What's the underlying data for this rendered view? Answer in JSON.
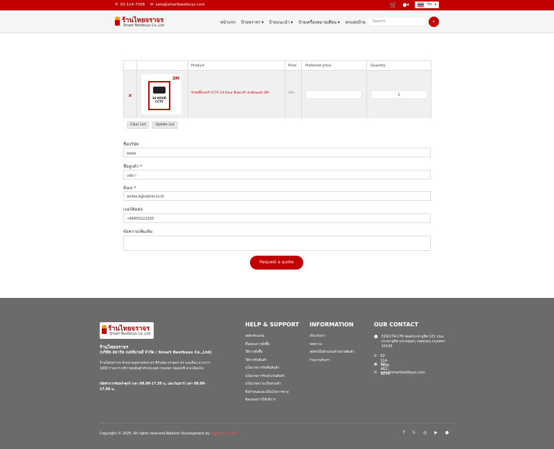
{
  "topbar": {
    "phone": "02-114-7006",
    "email": "sale@smartbestbuys.com",
    "lang": "TH"
  },
  "header": {
    "brand": "ร้านไทยจราจร",
    "brand_sub": "Smart Bestbuys Co.,Ltd",
    "search_placeholder": "Search",
    "nav": [
      "หน้าแรก",
      "ป้ายจราจร ▾",
      "ป้ายแนะนำ ▾",
      "ป้ายเครื่องหมายเตือน ▾",
      "ตกแต่งป้าย"
    ]
  },
  "cart": {
    "headers": {
      "product": "Product",
      "price": "Price",
      "preferred": "Preferred price",
      "quantity": "Quantity"
    },
    "item": {
      "name": "ป้ายสติ๊กเกอร์ CCTV 24 Hour สีแดง-ดำ สะท้อนแสง 3M",
      "price": "180",
      "quantity": "1",
      "image_text": "24 HOUR CCTV",
      "brand": "3M"
    },
    "clear": "Clear List",
    "update": "Update List"
  },
  "form": {
    "company_label": "ชื่อบริษัท",
    "company_value": "ทททท",
    "name_label": "ชื่อลูกค้า *",
    "name_value": "เจมิกา",
    "email_label": "อีเมล *",
    "email_value": "amika.b@cipher.co.th",
    "phone_label": "เบอร์ติดต่อ",
    "phone_value": "+66655222255",
    "msg_label": "ข้อความเพิ่มเติม",
    "submit": "Request a quote"
  },
  "footer": {
    "company": "ร้านไทยจราจร",
    "company_full": "(บริษัท สมาร์ท เบสท์บายส์ จำกัด / Smart Bestbuys Co.,Ltd)",
    "desc": "ร้านไทยจราจร จำหน่ายอุปกรณ์จราจร ที่กันชน กรวยจราจร และอื่นๆ มากกว่า 1000 รายการ บริการส่งสินค้าทั่วประเทศ กรุงเทพฯ จัดส่งฟรี ตามเงื่อนไข",
    "hours": "เปิดทำการจันทร์-ศุกร์ เวลา 08.00-17.30 น. และวันเสาร์ เวลา 08.00-17.00 น.",
    "help_title": "HELP & SUPPORT",
    "help": [
      "สมัครตัวแทน",
      "ขั้นตอนการสั่งซื้อ",
      "วิธีการสั่งซื้อ",
      "วิธีการรับสินค้า",
      "นโยบายการรับคืนสินค้า",
      "นโยบายการรับประกันสินค้า",
      "นโยบายความเป็นส่วนตัว",
      "ข้อกำหนดและเงื่อนไขการขาย",
      "ข้อเสนอการให้บริการ"
    ],
    "info_title": "INFORMATION",
    "info": [
      "เกี่ยวกับเรา",
      "บทความ",
      "สมัครเป็นตัวแทนจำหน่ายสินค้า",
      "ร่วมงานกับเรา"
    ],
    "contact_title": "OUR CONTACT",
    "address": "519/174-176 ซอยประชาอุทิศ 121 ถนนประชาอุทิศ แขวงทุ่งครุ เขตทุ่งครุ กรุงเทพฯ 10140",
    "phone": "02-114-7006",
    "fax": "02-462-8274",
    "email": "sale@smartbestbuys.com",
    "copyright": "Copyright © 2025. All rights reserved.Website Development by",
    "dev": "Cipher Co., Ltd."
  }
}
